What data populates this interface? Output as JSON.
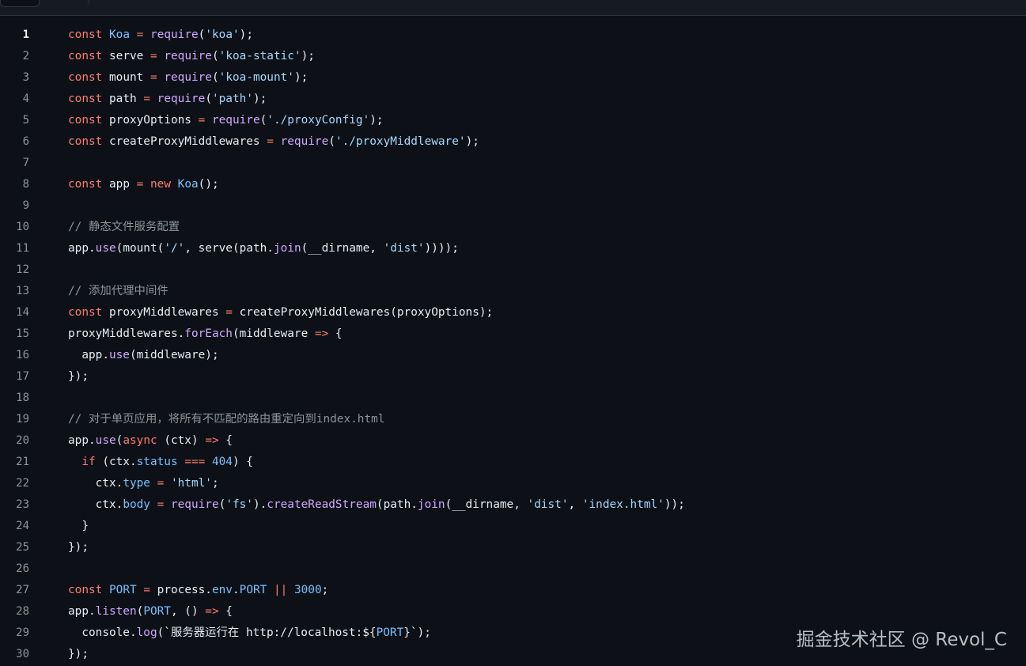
{
  "colors": {
    "background": "#0d1117",
    "text": "#e6edf3",
    "keyword": "#ff7b72",
    "string": "#a5d6ff",
    "function": "#d2a8ff",
    "constant": "#79c0ff",
    "comment": "#8b949e",
    "line_number": "#8b949e"
  },
  "editor": {
    "current_line": 1,
    "lines": [
      {
        "n": "1",
        "tokens": [
          [
            "k",
            "const"
          ],
          [
            "t",
            " "
          ],
          [
            "c",
            "Koa"
          ],
          [
            "t",
            " "
          ],
          [
            "k",
            "="
          ],
          [
            "t",
            " "
          ],
          [
            "f",
            "require"
          ],
          [
            "t",
            "("
          ],
          [
            "s",
            "'koa'"
          ],
          [
            "t",
            ");"
          ]
        ]
      },
      {
        "n": "2",
        "tokens": [
          [
            "k",
            "const"
          ],
          [
            "t",
            " serve "
          ],
          [
            "k",
            "="
          ],
          [
            "t",
            " "
          ],
          [
            "f",
            "require"
          ],
          [
            "t",
            "("
          ],
          [
            "s",
            "'koa-static'"
          ],
          [
            "t",
            ");"
          ]
        ]
      },
      {
        "n": "3",
        "tokens": [
          [
            "k",
            "const"
          ],
          [
            "t",
            " mount "
          ],
          [
            "k",
            "="
          ],
          [
            "t",
            " "
          ],
          [
            "f",
            "require"
          ],
          [
            "t",
            "("
          ],
          [
            "s",
            "'koa-mount'"
          ],
          [
            "t",
            ");"
          ]
        ]
      },
      {
        "n": "4",
        "tokens": [
          [
            "k",
            "const"
          ],
          [
            "t",
            " path "
          ],
          [
            "k",
            "="
          ],
          [
            "t",
            " "
          ],
          [
            "f",
            "require"
          ],
          [
            "t",
            "("
          ],
          [
            "s",
            "'path'"
          ],
          [
            "t",
            ");"
          ]
        ]
      },
      {
        "n": "5",
        "tokens": [
          [
            "k",
            "const"
          ],
          [
            "t",
            " proxyOptions "
          ],
          [
            "k",
            "="
          ],
          [
            "t",
            " "
          ],
          [
            "f",
            "require"
          ],
          [
            "t",
            "("
          ],
          [
            "s",
            "'./proxyConfig'"
          ],
          [
            "t",
            ");"
          ]
        ]
      },
      {
        "n": "6",
        "tokens": [
          [
            "k",
            "const"
          ],
          [
            "t",
            " createProxyMiddlewares "
          ],
          [
            "k",
            "="
          ],
          [
            "t",
            " "
          ],
          [
            "f",
            "require"
          ],
          [
            "t",
            "("
          ],
          [
            "s",
            "'./proxyMiddleware'"
          ],
          [
            "t",
            ");"
          ]
        ]
      },
      {
        "n": "7",
        "tokens": []
      },
      {
        "n": "8",
        "tokens": [
          [
            "k",
            "const"
          ],
          [
            "t",
            " app "
          ],
          [
            "k",
            "="
          ],
          [
            "t",
            " "
          ],
          [
            "k",
            "new"
          ],
          [
            "t",
            " "
          ],
          [
            "c",
            "Koa"
          ],
          [
            "t",
            "();"
          ]
        ]
      },
      {
        "n": "9",
        "tokens": []
      },
      {
        "n": "10",
        "tokens": [
          [
            "m",
            "// 静态文件服务配置"
          ]
        ]
      },
      {
        "n": "11",
        "tokens": [
          [
            "t",
            "app."
          ],
          [
            "f",
            "use"
          ],
          [
            "t",
            "(mount("
          ],
          [
            "s",
            "'/'"
          ],
          [
            "t",
            ", serve(path."
          ],
          [
            "f",
            "join"
          ],
          [
            "t",
            "(__dirname, "
          ],
          [
            "s",
            "'dist'"
          ],
          [
            "t",
            "))));"
          ]
        ]
      },
      {
        "n": "12",
        "tokens": []
      },
      {
        "n": "13",
        "tokens": [
          [
            "m",
            "// 添加代理中间件"
          ]
        ]
      },
      {
        "n": "14",
        "tokens": [
          [
            "k",
            "const"
          ],
          [
            "t",
            " proxyMiddlewares "
          ],
          [
            "k",
            "="
          ],
          [
            "t",
            " createProxyMiddlewares(proxyOptions);"
          ]
        ]
      },
      {
        "n": "15",
        "tokens": [
          [
            "t",
            "proxyMiddlewares."
          ],
          [
            "f",
            "forEach"
          ],
          [
            "t",
            "(middleware "
          ],
          [
            "k",
            "=>"
          ],
          [
            "t",
            " {"
          ]
        ]
      },
      {
        "n": "16",
        "tokens": [
          [
            "t",
            "  app."
          ],
          [
            "f",
            "use"
          ],
          [
            "t",
            "(middleware);"
          ]
        ]
      },
      {
        "n": "17",
        "tokens": [
          [
            "t",
            "});"
          ]
        ]
      },
      {
        "n": "18",
        "tokens": []
      },
      {
        "n": "19",
        "tokens": [
          [
            "m",
            "// 对于单页应用，将所有不匹配的路由重定向到index.html"
          ]
        ]
      },
      {
        "n": "20",
        "tokens": [
          [
            "t",
            "app."
          ],
          [
            "f",
            "use"
          ],
          [
            "t",
            "("
          ],
          [
            "k",
            "async"
          ],
          [
            "t",
            " (ctx) "
          ],
          [
            "k",
            "=>"
          ],
          [
            "t",
            " {"
          ]
        ]
      },
      {
        "n": "21",
        "tokens": [
          [
            "t",
            "  "
          ],
          [
            "k",
            "if"
          ],
          [
            "t",
            " (ctx."
          ],
          [
            "c",
            "status"
          ],
          [
            "t",
            " "
          ],
          [
            "k",
            "==="
          ],
          [
            "t",
            " "
          ],
          [
            "c",
            "404"
          ],
          [
            "t",
            ") {"
          ]
        ]
      },
      {
        "n": "22",
        "tokens": [
          [
            "t",
            "    ctx."
          ],
          [
            "c",
            "type"
          ],
          [
            "t",
            " "
          ],
          [
            "k",
            "="
          ],
          [
            "t",
            " "
          ],
          [
            "s",
            "'html'"
          ],
          [
            "t",
            ";"
          ]
        ]
      },
      {
        "n": "23",
        "tokens": [
          [
            "t",
            "    ctx."
          ],
          [
            "c",
            "body"
          ],
          [
            "t",
            " "
          ],
          [
            "k",
            "="
          ],
          [
            "t",
            " "
          ],
          [
            "f",
            "require"
          ],
          [
            "t",
            "("
          ],
          [
            "s",
            "'fs'"
          ],
          [
            "t",
            ")."
          ],
          [
            "f",
            "createReadStream"
          ],
          [
            "t",
            "(path."
          ],
          [
            "f",
            "join"
          ],
          [
            "t",
            "(__dirname, "
          ],
          [
            "s",
            "'dist'"
          ],
          [
            "t",
            ", "
          ],
          [
            "s",
            "'index.html'"
          ],
          [
            "t",
            "));"
          ]
        ]
      },
      {
        "n": "24",
        "tokens": [
          [
            "t",
            "  }"
          ]
        ]
      },
      {
        "n": "25",
        "tokens": [
          [
            "t",
            "});"
          ]
        ]
      },
      {
        "n": "26",
        "tokens": []
      },
      {
        "n": "27",
        "tokens": [
          [
            "k",
            "const"
          ],
          [
            "t",
            " "
          ],
          [
            "c",
            "PORT"
          ],
          [
            "t",
            " "
          ],
          [
            "k",
            "="
          ],
          [
            "t",
            " process."
          ],
          [
            "c",
            "env"
          ],
          [
            "t",
            "."
          ],
          [
            "c",
            "PORT"
          ],
          [
            "t",
            " "
          ],
          [
            "k",
            "||"
          ],
          [
            "t",
            " "
          ],
          [
            "c",
            "3000"
          ],
          [
            "t",
            ";"
          ]
        ]
      },
      {
        "n": "28",
        "tokens": [
          [
            "t",
            "app."
          ],
          [
            "f",
            "listen"
          ],
          [
            "t",
            "("
          ],
          [
            "c",
            "PORT"
          ],
          [
            "t",
            ", () "
          ],
          [
            "k",
            "=>"
          ],
          [
            "t",
            " {"
          ]
        ]
      },
      {
        "n": "29",
        "tokens": [
          [
            "t",
            "  console."
          ],
          [
            "f",
            "log"
          ],
          [
            "t",
            "(`服务器运行在 http://localhost:${"
          ],
          [
            "c",
            "PORT"
          ],
          [
            "t",
            "}`);"
          ]
        ]
      },
      {
        "n": "30",
        "tokens": [
          [
            "t",
            "});"
          ]
        ]
      }
    ]
  },
  "watermark": {
    "text": "掘金技术社区 @ Revol_C"
  }
}
